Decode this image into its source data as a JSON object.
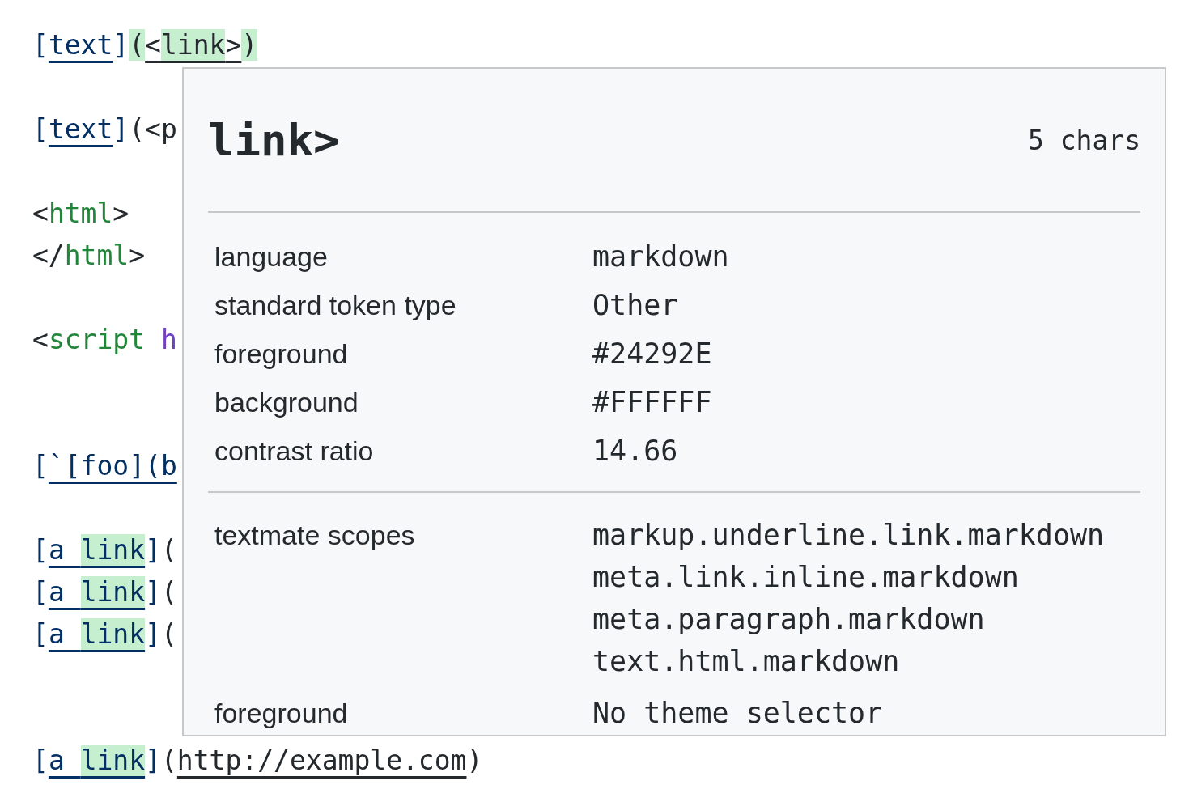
{
  "editor": {
    "lines": [
      {
        "kind": "code",
        "segments": [
          {
            "text": "[",
            "kind": "bracket",
            "highlight": false
          },
          {
            "text": "text",
            "kind": "linktext",
            "highlight": false
          },
          {
            "text": "]",
            "kind": "bracket",
            "highlight": false
          },
          {
            "text": "(",
            "kind": "plain",
            "highlight": true
          },
          {
            "text": "<",
            "kind": "url",
            "highlight": false
          },
          {
            "text": "link",
            "kind": "url",
            "highlight": true
          },
          {
            "text": ">",
            "kind": "url",
            "highlight": false
          },
          {
            "text": ")",
            "kind": "plain",
            "highlight": true
          }
        ]
      },
      {
        "kind": "blank"
      },
      {
        "kind": "code",
        "segments": [
          {
            "text": "[",
            "kind": "bracket",
            "highlight": false
          },
          {
            "text": "text",
            "kind": "linktext",
            "highlight": false
          },
          {
            "text": "]",
            "kind": "bracket",
            "highlight": false
          },
          {
            "text": "(<p",
            "kind": "plain",
            "highlight": false
          }
        ]
      },
      {
        "kind": "blank"
      },
      {
        "kind": "code",
        "segments": [
          {
            "text": "<",
            "kind": "plain",
            "highlight": false
          },
          {
            "text": "html",
            "kind": "tag",
            "highlight": false
          },
          {
            "text": ">",
            "kind": "plain",
            "highlight": false
          }
        ]
      },
      {
        "kind": "code",
        "segments": [
          {
            "text": "</",
            "kind": "plain",
            "highlight": false
          },
          {
            "text": "html",
            "kind": "tag",
            "highlight": false
          },
          {
            "text": ">",
            "kind": "plain",
            "highlight": false
          }
        ]
      },
      {
        "kind": "blank"
      },
      {
        "kind": "code",
        "segments": [
          {
            "text": "<",
            "kind": "plain",
            "highlight": false
          },
          {
            "text": "script",
            "kind": "tag",
            "highlight": false
          },
          {
            "text": "h",
            "kind": "attr",
            "highlight": false
          }
        ]
      },
      {
        "kind": "blank"
      },
      {
        "kind": "blank"
      },
      {
        "kind": "code",
        "segments": [
          {
            "text": "[",
            "kind": "bracket",
            "highlight": false
          },
          {
            "text": "`[foo](b",
            "kind": "linktext",
            "highlight": false
          }
        ]
      },
      {
        "kind": "blank"
      },
      {
        "kind": "code",
        "segments": [
          {
            "text": "[",
            "kind": "bracket",
            "highlight": false
          },
          {
            "text": "a ",
            "kind": "linktext",
            "highlight": false
          },
          {
            "text": "link",
            "kind": "linktext",
            "highlight": true
          },
          {
            "text": "]",
            "kind": "bracket",
            "highlight": false
          },
          {
            "text": "(",
            "kind": "plain",
            "highlight": false
          }
        ]
      },
      {
        "kind": "code",
        "segments": [
          {
            "text": "[",
            "kind": "bracket",
            "highlight": false
          },
          {
            "text": "a ",
            "kind": "linktext",
            "highlight": false
          },
          {
            "text": "link",
            "kind": "linktext",
            "highlight": true
          },
          {
            "text": "]",
            "kind": "bracket",
            "highlight": false
          },
          {
            "text": "(",
            "kind": "plain",
            "highlight": false
          }
        ]
      },
      {
        "kind": "code",
        "segments": [
          {
            "text": "[",
            "kind": "bracket",
            "highlight": false
          },
          {
            "text": "a ",
            "kind": "linktext",
            "highlight": false
          },
          {
            "text": "link",
            "kind": "linktext",
            "highlight": true
          },
          {
            "text": "]",
            "kind": "bracket",
            "highlight": false
          },
          {
            "text": "(",
            "kind": "plain",
            "highlight": false
          }
        ]
      },
      {
        "kind": "blank"
      },
      {
        "kind": "blank"
      },
      {
        "kind": "code",
        "segments": [
          {
            "text": "[",
            "kind": "bracket",
            "highlight": false
          },
          {
            "text": "a ",
            "kind": "linktext",
            "highlight": false
          },
          {
            "text": "link",
            "kind": "linktext",
            "highlight": true
          },
          {
            "text": "]",
            "kind": "bracket",
            "highlight": false
          },
          {
            "text": "(",
            "kind": "plain",
            "highlight": false
          },
          {
            "text": "http://example.com",
            "kind": "url",
            "highlight": false
          },
          {
            "text": ")",
            "kind": "plain",
            "highlight": false
          }
        ]
      }
    ]
  },
  "inspect_popup": {
    "token": "link>",
    "length": "5 chars",
    "sections": [
      {
        "rows": [
          {
            "label": "language",
            "values": [
              "markdown"
            ]
          },
          {
            "label": "standard token type",
            "values": [
              "Other"
            ]
          },
          {
            "label": "foreground",
            "values": [
              "#24292E"
            ]
          },
          {
            "label": "background",
            "values": [
              "#FFFFFF"
            ]
          },
          {
            "label": "contrast ratio",
            "values": [
              "14.66"
            ]
          }
        ]
      },
      {
        "rows": [
          {
            "label": "textmate scopes",
            "values": [
              "markup.underline.link.markdown",
              "meta.link.inline.markdown",
              "meta.paragraph.markdown",
              "text.html.markdown"
            ]
          },
          {
            "label": "foreground",
            "values": [
              "No theme selector"
            ]
          }
        ]
      }
    ]
  }
}
